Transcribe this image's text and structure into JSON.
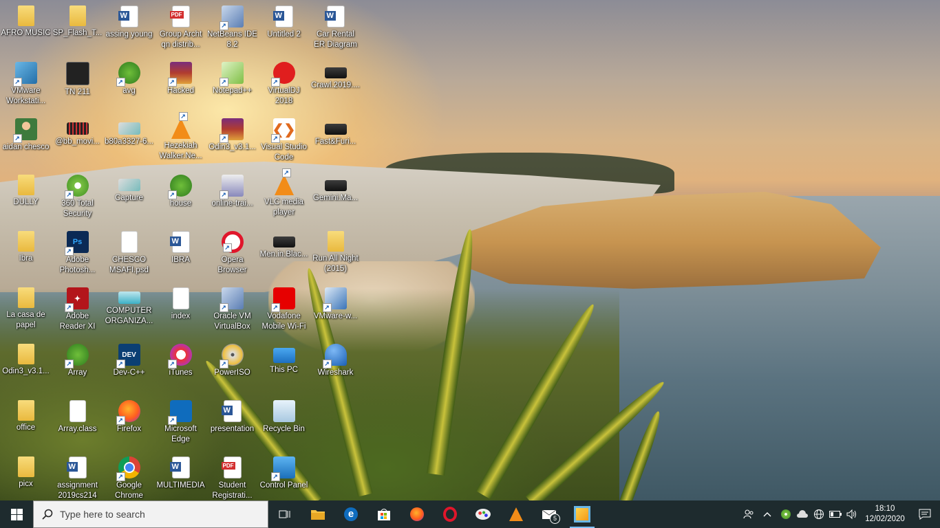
{
  "desktop": {
    "icons": [
      {
        "label": "AFRO MUSIC",
        "icon": "folder-icon"
      },
      {
        "label": "SP_Flash_T...",
        "icon": "folder-icon"
      },
      {
        "label": "assing young",
        "icon": "word-document-icon"
      },
      {
        "label": "Group Archt qn distrib...",
        "icon": "pdf-icon"
      },
      {
        "label": "NetBeans IDE 8.2",
        "icon": "netbeans-icon"
      },
      {
        "label": "Untitled 2",
        "icon": "word-document-icon"
      },
      {
        "label": "Car Rental ER Diagram",
        "icon": "word-document-icon"
      },
      {
        "label": "VMware Workstati...",
        "icon": "vmware-workstation-icon"
      },
      {
        "label": "TN 211",
        "icon": "video-file-icon"
      },
      {
        "label": "avg",
        "icon": "frog-icon"
      },
      {
        "label": "Hacked",
        "icon": "winrar-icon"
      },
      {
        "label": "Notepad++",
        "icon": "notepad-plus-plus-icon"
      },
      {
        "label": "VirtualDJ 2018",
        "icon": "virtualdj-icon"
      },
      {
        "label": "Crawl.2019....",
        "icon": "video-thumbnail-icon"
      },
      {
        "label": "aidan chesco",
        "icon": "user-folder-icon"
      },
      {
        "label": "@bb_movi...",
        "icon": "film-strip-icon"
      },
      {
        "label": "b80a3327-6...",
        "icon": "image-file-icon"
      },
      {
        "label": "Hezekiah Walker.Ne...",
        "icon": "vlc-icon"
      },
      {
        "label": "Odin3_v3.1...",
        "icon": "winrar-icon"
      },
      {
        "label": "Visual Studio Code",
        "icon": "vscode-icon"
      },
      {
        "label": "Fast&Furi...",
        "icon": "video-thumbnail-icon"
      },
      {
        "label": "DULLY",
        "icon": "folder-icon"
      },
      {
        "label": "360 Total Security",
        "icon": "360-security-icon"
      },
      {
        "label": "Capture",
        "icon": "image-file-icon"
      },
      {
        "label": "house",
        "icon": "frog-icon"
      },
      {
        "label": "online-trai...",
        "icon": "network-file-icon"
      },
      {
        "label": "VLC media player",
        "icon": "vlc-icon"
      },
      {
        "label": "Gemini.Ma...",
        "icon": "video-thumbnail-icon"
      },
      {
        "label": "Ibra",
        "icon": "folder-icon"
      },
      {
        "label": "Adobe Photosh...",
        "icon": "photoshop-icon"
      },
      {
        "label": "CHESCO MSAFI.psd",
        "icon": "blank-file-icon"
      },
      {
        "label": "IBRA",
        "icon": "word-document-icon"
      },
      {
        "label": "Opera Browser",
        "icon": "opera-icon"
      },
      {
        "label": "Men.in.Blac...",
        "icon": "video-thumbnail-icon"
      },
      {
        "label": "Run All Night (2015)",
        "icon": "folder-icon"
      },
      {
        "label": "La casa de papel",
        "icon": "folder-icon"
      },
      {
        "label": "Adobe Reader XI",
        "icon": "adobe-reader-icon"
      },
      {
        "label": "COMPUTER ORGANIZA...",
        "icon": "card-image-icon"
      },
      {
        "label": "index",
        "icon": "blank-file-icon"
      },
      {
        "label": "Oracle VM VirtualBox",
        "icon": "virtualbox-icon"
      },
      {
        "label": "Vodafone Mobile Wi-Fi",
        "icon": "vodafone-icon"
      },
      {
        "label": "VMware-w...",
        "icon": "vmware-installer-icon"
      },
      {
        "label": "Odin3_v3.1...",
        "icon": "folder-icon"
      },
      {
        "label": "Array",
        "icon": "frog-icon"
      },
      {
        "label": "Dev-C++",
        "icon": "devcpp-icon"
      },
      {
        "label": "iTunes",
        "icon": "itunes-icon"
      },
      {
        "label": "PowerISO",
        "icon": "poweriso-icon"
      },
      {
        "label": "This PC",
        "icon": "this-pc-icon"
      },
      {
        "label": "Wireshark",
        "icon": "wireshark-icon"
      },
      {
        "label": "office",
        "icon": "folder-icon"
      },
      {
        "label": "Array.class",
        "icon": "blank-file-icon"
      },
      {
        "label": "Firefox",
        "icon": "firefox-icon"
      },
      {
        "label": "Microsoft Edge",
        "icon": "edge-icon"
      },
      {
        "label": "presentation",
        "icon": "word-document-icon"
      },
      {
        "label": "Recycle Bin",
        "icon": "recycle-bin-icon"
      },
      {
        "label": "picx",
        "icon": "folder-icon"
      },
      {
        "label": "assignment 2019cs214",
        "icon": "word-document-icon"
      },
      {
        "label": "Google Chrome",
        "icon": "chrome-icon"
      },
      {
        "label": "MULTIMEDIA",
        "icon": "word-document-icon"
      },
      {
        "label": "Student Registrati...",
        "icon": "pdf-icon"
      },
      {
        "label": "Control Panel",
        "icon": "control-panel-icon"
      }
    ]
  },
  "taskbar": {
    "search_placeholder": "Type here to search",
    "pinned": [
      {
        "name": "task-view-icon"
      },
      {
        "name": "file-explorer-icon"
      },
      {
        "name": "edge-icon"
      },
      {
        "name": "store-icon"
      },
      {
        "name": "firefox-icon"
      },
      {
        "name": "opera-icon"
      },
      {
        "name": "paint-icon"
      },
      {
        "name": "vlc-icon"
      },
      {
        "name": "mail-icon",
        "badge": "5"
      },
      {
        "name": "vmware-workstation-icon",
        "active": true
      }
    ],
    "tray": {
      "time": "18:10",
      "date": "12/02/2020"
    }
  },
  "colors": {
    "taskbar_bg": "#1e2b2e",
    "accent": "#7cc0ff"
  }
}
